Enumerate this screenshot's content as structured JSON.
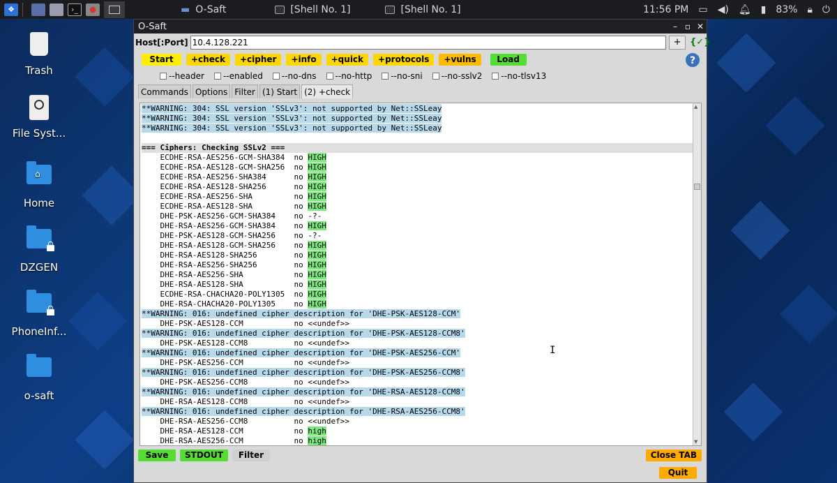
{
  "taskbar": {
    "tasks": [
      {
        "label": "O-Saft"
      },
      {
        "label": "[Shell No. 1]"
      },
      {
        "label": "[Shell No. 1]"
      }
    ],
    "clock": "11:56 PM",
    "battery": "83%"
  },
  "desktop": {
    "icons": [
      {
        "label": "Trash"
      },
      {
        "label": "File Syst..."
      },
      {
        "label": "Home"
      },
      {
        "label": "DZGEN"
      },
      {
        "label": "PhoneInf..."
      },
      {
        "label": "o-saft"
      }
    ]
  },
  "window": {
    "title": "O-Saft",
    "host_label": "Host[:Port]",
    "host_value": "10.4.128.221",
    "plus": "+",
    "commands": [
      {
        "label": "Start"
      },
      {
        "label": "+check"
      },
      {
        "label": "+cipher"
      },
      {
        "label": "+info"
      },
      {
        "label": "+quick"
      },
      {
        "label": "+protocols"
      },
      {
        "label": "+vulns"
      },
      {
        "label": "Load"
      }
    ],
    "help": "?",
    "options": [
      "--header",
      "--enabled",
      "--no-dns",
      "--no-http",
      "--no-sni",
      "--no-sslv2",
      "--no-tlsv13"
    ],
    "tabs": [
      "Commands",
      "Options",
      "Filter",
      "(1) Start",
      "(2) +check"
    ],
    "bottom": {
      "save": "Save",
      "stdout": "STDOUT",
      "filter": "Filter",
      "close_tab": "Close TAB",
      "quit": "Quit"
    }
  },
  "output": [
    {
      "t": "**WARNING: 304: SSL version 'SSLv3': not supported by Net::SSLeay",
      "k": "warn"
    },
    {
      "t": "**WARNING: 304: SSL version 'SSLv3': not supported by Net::SSLeay",
      "k": "warn"
    },
    {
      "t": "**WARNING: 304: SSL version 'SSLv3': not supported by Net::SSLeay",
      "k": "warn"
    },
    {
      "t": "",
      "k": "plain"
    },
    {
      "t": "=== Ciphers: Checking SSLv2 ===",
      "k": "hdr"
    },
    {
      "t": "    ECDHE-RSA-AES256-GCM-SHA384  no ",
      "h": "HIGH",
      "k": "cipher"
    },
    {
      "t": "    ECDHE-RSA-AES128-GCM-SHA256  no ",
      "h": "HIGH",
      "k": "cipher"
    },
    {
      "t": "    ECDHE-RSA-AES256-SHA384      no ",
      "h": "HIGH",
      "k": "cipher"
    },
    {
      "t": "    ECDHE-RSA-AES128-SHA256      no ",
      "h": "HIGH",
      "k": "cipher"
    },
    {
      "t": "    ECDHE-RSA-AES256-SHA         no ",
      "h": "HIGH",
      "k": "cipher"
    },
    {
      "t": "    ECDHE-RSA-AES128-SHA         no ",
      "h": "HIGH",
      "k": "cipher"
    },
    {
      "t": "    DHE-PSK-AES256-GCM-SHA384    no -?-",
      "k": "plain"
    },
    {
      "t": "    DHE-RSA-AES256-GCM-SHA384    no ",
      "h": "HIGH",
      "k": "cipher"
    },
    {
      "t": "    DHE-PSK-AES128-GCM-SHA256    no -?-",
      "k": "plain"
    },
    {
      "t": "    DHE-RSA-AES128-GCM-SHA256    no ",
      "h": "HIGH",
      "k": "cipher"
    },
    {
      "t": "    DHE-RSA-AES128-SHA256        no ",
      "h": "HIGH",
      "k": "cipher"
    },
    {
      "t": "    DHE-RSA-AES256-SHA256        no ",
      "h": "HIGH",
      "k": "cipher"
    },
    {
      "t": "    DHE-RSA-AES256-SHA           no ",
      "h": "HIGH",
      "k": "cipher"
    },
    {
      "t": "    DHE-RSA-AES128-SHA           no ",
      "h": "HIGH",
      "k": "cipher"
    },
    {
      "t": "    ECDHE-RSA-CHACHA20-POLY1305  no ",
      "h": "HIGH",
      "k": "cipher"
    },
    {
      "t": "    DHE-RSA-CHACHA20-POLY1305    no ",
      "h": "HIGH",
      "k": "cipher"
    },
    {
      "t": "**WARNING: 016: undefined cipher description for 'DHE-PSK-AES128-CCM'",
      "k": "warn"
    },
    {
      "t": "    DHE-PSK-AES128-CCM           no <<undef>>",
      "k": "plain"
    },
    {
      "t": "**WARNING: 016: undefined cipher description for 'DHE-PSK-AES128-CCM8'",
      "k": "warn"
    },
    {
      "t": "    DHE-PSK-AES128-CCM8          no <<undef>>",
      "k": "plain"
    },
    {
      "t": "**WARNING: 016: undefined cipher description for 'DHE-PSK-AES256-CCM'",
      "k": "warn"
    },
    {
      "t": "    DHE-PSK-AES256-CCM           no <<undef>>",
      "k": "plain"
    },
    {
      "t": "**WARNING: 016: undefined cipher description for 'DHE-PSK-AES256-CCM8'",
      "k": "warn"
    },
    {
      "t": "    DHE-PSK-AES256-CCM8          no <<undef>>",
      "k": "plain"
    },
    {
      "t": "**WARNING: 016: undefined cipher description for 'DHE-RSA-AES128-CCM8'",
      "k": "warn"
    },
    {
      "t": "    DHE-RSA-AES128-CCM8          no <<undef>>",
      "k": "plain"
    },
    {
      "t": "**WARNING: 016: undefined cipher description for 'DHE-RSA-AES256-CCM8'",
      "k": "warn"
    },
    {
      "t": "    DHE-RSA-AES256-CCM8          no <<undef>>",
      "k": "plain"
    },
    {
      "t": "    DHE-RSA-AES128-CCM           no ",
      "h": "high",
      "k": "cipher"
    },
    {
      "t": "    DHE-RSA-AES256-CCM           no ",
      "h": "high",
      "k": "cipher"
    }
  ]
}
